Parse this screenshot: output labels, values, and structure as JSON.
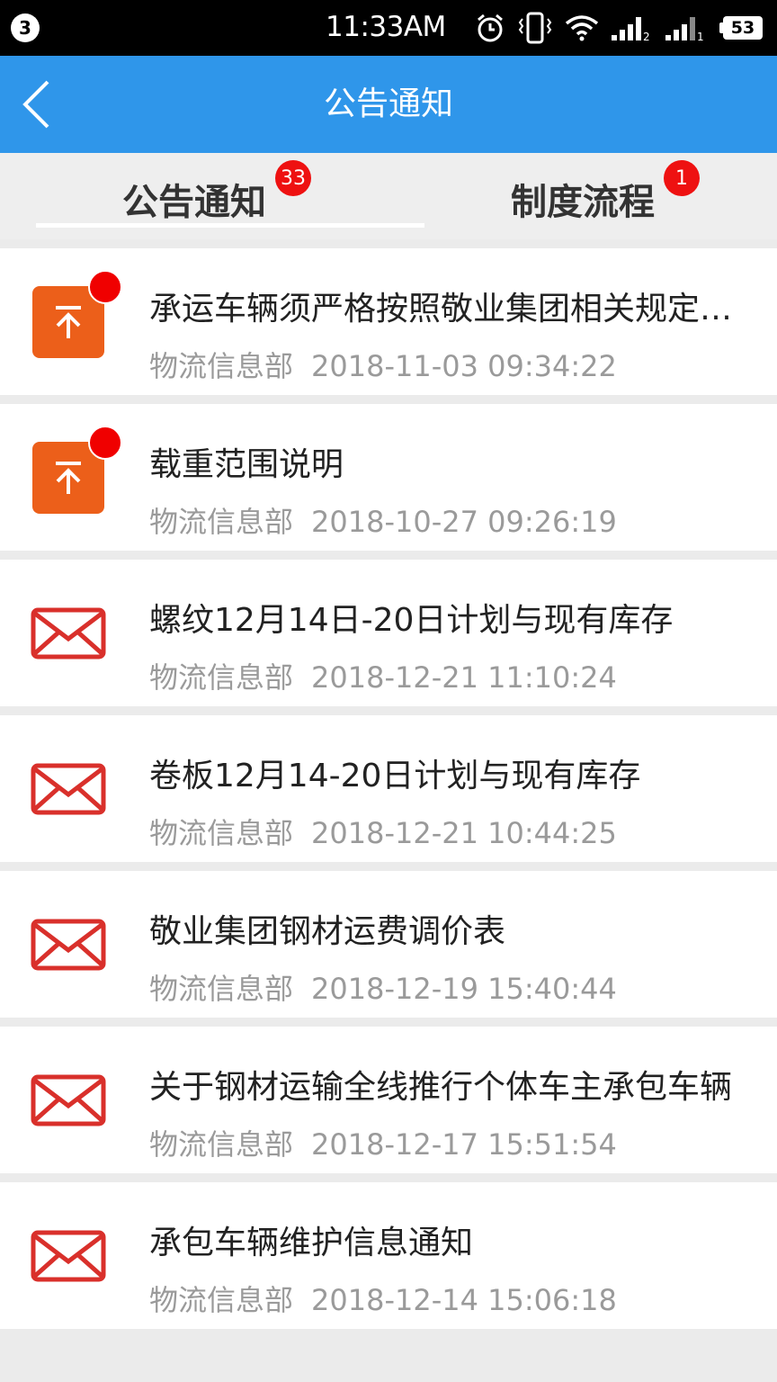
{
  "status_bar": {
    "notification_count": "3",
    "time": "11:33AM",
    "battery": "53",
    "icons": [
      "alarm-icon",
      "vibrate-icon",
      "wifi-icon",
      "signal-icon",
      "signal-icon",
      "battery-icon"
    ]
  },
  "header": {
    "title": "公告通知",
    "background_color": "#2f96ea"
  },
  "tabs": [
    {
      "label": "公告通知",
      "badge": "33",
      "active": true
    },
    {
      "label": "制度流程",
      "badge": "1",
      "active": false
    }
  ],
  "items": [
    {
      "icon": "pin-top-icon",
      "unread": true,
      "title": "承运车辆须严格按照敬业集团相关规定执行",
      "sender": "物流信息部",
      "time": "2018-11-03 09:34:22"
    },
    {
      "icon": "pin-top-icon",
      "unread": true,
      "title": "载重范围说明",
      "sender": "物流信息部",
      "time": "2018-10-27 09:26:19"
    },
    {
      "icon": "envelope-icon",
      "unread": false,
      "title": "螺纹12月14日-20日计划与现有库存",
      "sender": "物流信息部",
      "time": "2018-12-21 11:10:24"
    },
    {
      "icon": "envelope-icon",
      "unread": false,
      "title": "卷板12月14-20日计划与现有库存",
      "sender": "物流信息部",
      "time": "2018-12-21 10:44:25"
    },
    {
      "icon": "envelope-icon",
      "unread": false,
      "title": "敬业集团钢材运费调价表",
      "sender": "物流信息部",
      "time": "2018-12-19 15:40:44"
    },
    {
      "icon": "envelope-icon",
      "unread": false,
      "title": "关于钢材运输全线推行个体车主承包车辆",
      "sender": "物流信息部",
      "time": "2018-12-17 15:51:54"
    },
    {
      "icon": "envelope-icon",
      "unread": false,
      "title": "承包车辆维护信息通知",
      "sender": "物流信息部",
      "time": "2018-12-14 15:06:18"
    }
  ],
  "colors": {
    "pin_orange": "#ec5f1a",
    "envelope_red": "#d9302b",
    "badge_red": "#ee1111"
  }
}
